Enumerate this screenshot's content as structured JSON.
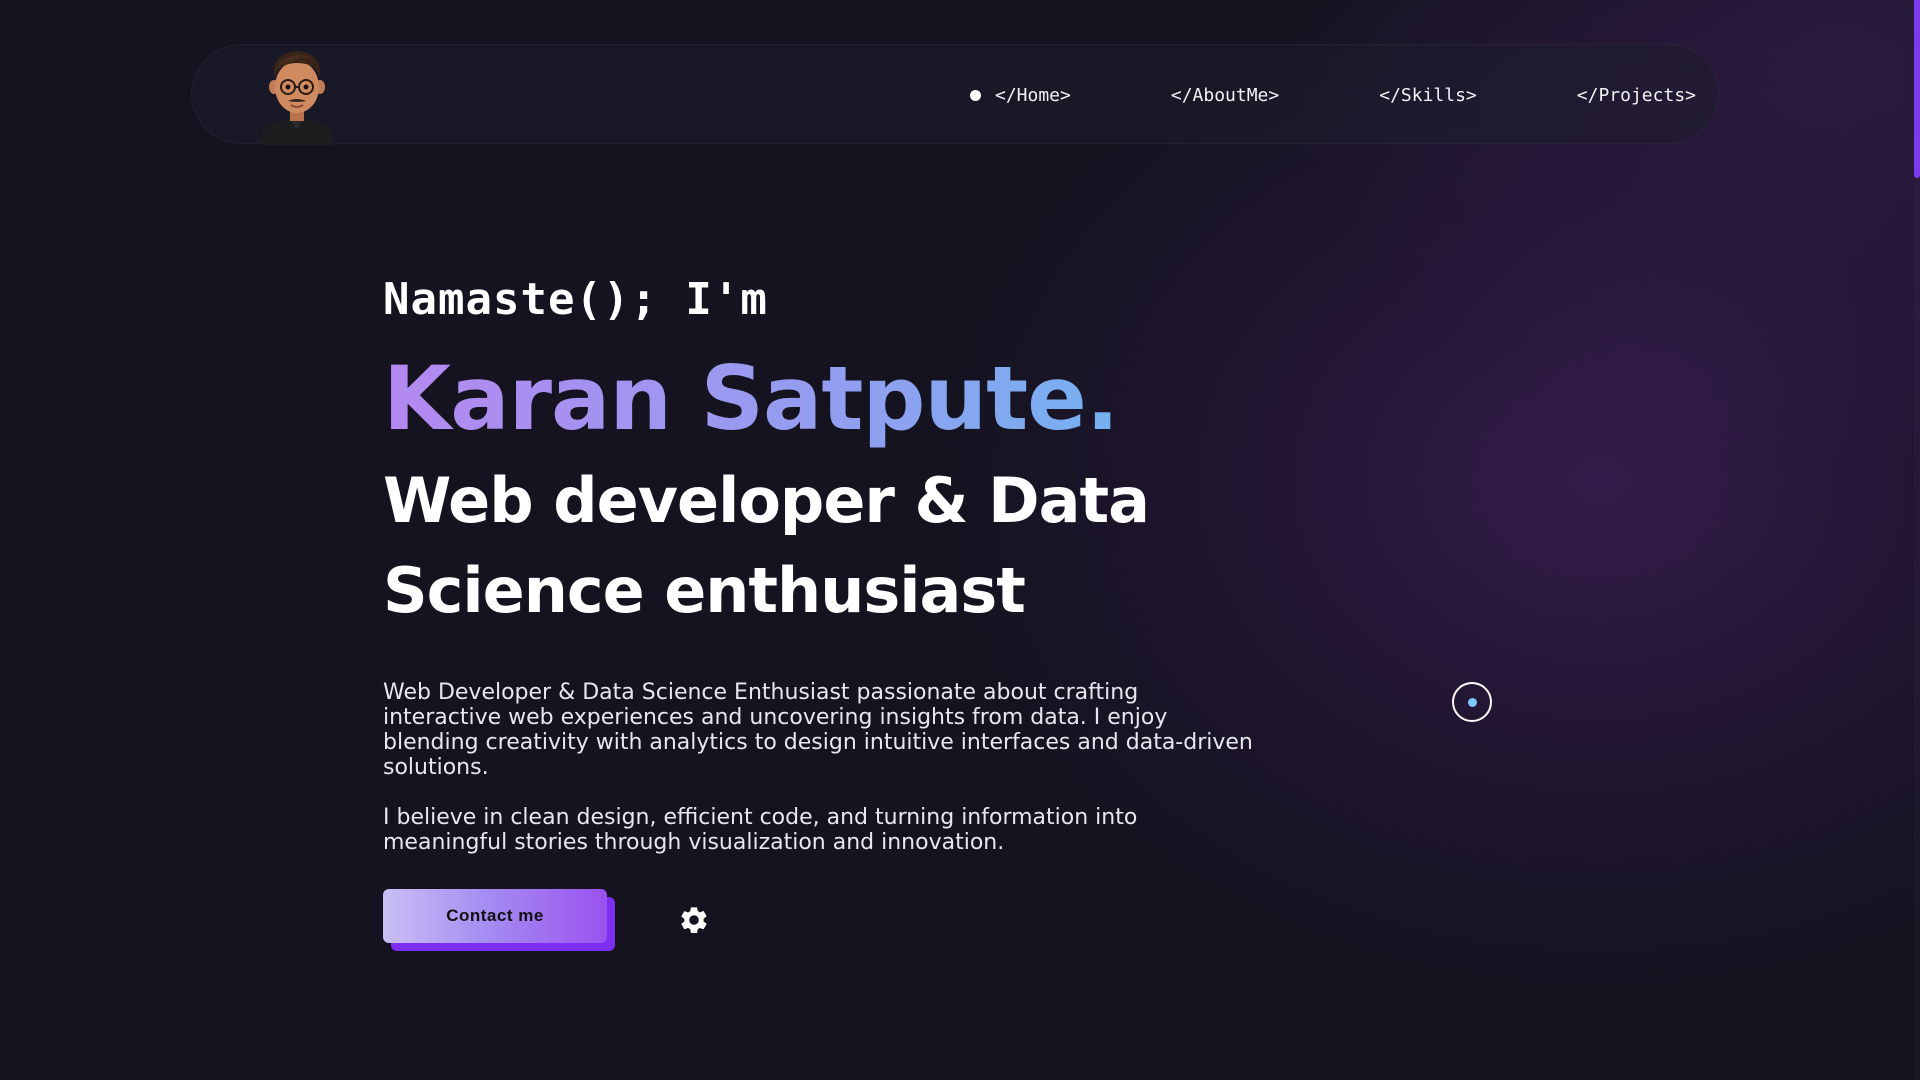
{
  "nav": {
    "avatar_icon": "avatar-cartoon-icon",
    "items": [
      {
        "label": "</Home>",
        "active": true
      },
      {
        "label": "</AboutMe>",
        "active": false
      },
      {
        "label": "</Skills>",
        "active": false
      },
      {
        "label": "</Projects>",
        "active": false
      }
    ]
  },
  "hero": {
    "greeting": "Namaste(); I'm",
    "name": "Karan Satpute.",
    "role": "Web developer & Data Science enthusiast",
    "bio": [
      "Web Developer & Data Science Enthusiast passionate about crafting interactive web experiences and uncovering insights from data. I enjoy blending creativity with analytics to design intuitive interfaces and data-driven solutions.",
      "I believe in clean design, efficient code, and turning information into meaningful stories through visualization and innovation."
    ]
  },
  "actions": {
    "contact_label": "Contact me",
    "settings_icon": "gear-icon"
  },
  "colors": {
    "background": "#14131f",
    "accent_purple": "#7c2ff0",
    "name_gradient_start": "#b488f0",
    "name_gradient_end": "#5fc0ee",
    "cursor_dot": "#7cc8ff"
  }
}
